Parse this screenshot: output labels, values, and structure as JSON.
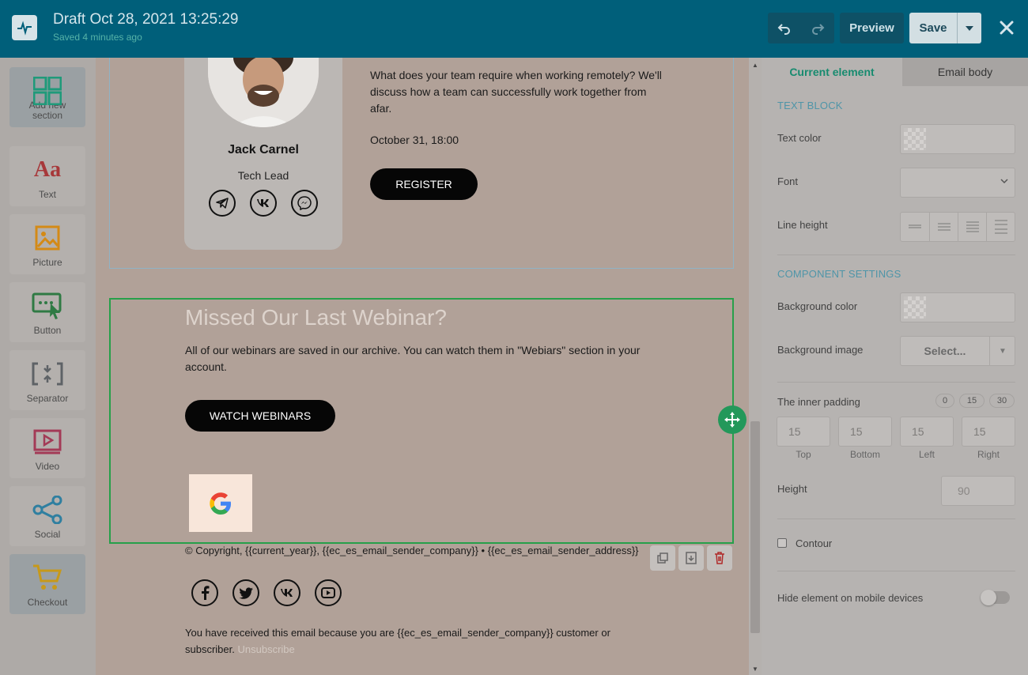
{
  "header": {
    "draft_title": "Draft Oct 28, 2021 13:25:29",
    "saved_status": "Saved 4 minutes ago",
    "preview_label": "Preview",
    "save_label": "Save"
  },
  "toolbox": {
    "items": [
      {
        "label": "Add new section",
        "icon": "add-section-icon"
      },
      {
        "label": "Text",
        "icon": "text-icon"
      },
      {
        "label": "Picture",
        "icon": "picture-icon"
      },
      {
        "label": "Button",
        "icon": "button-icon"
      },
      {
        "label": "Separator",
        "icon": "separator-icon"
      },
      {
        "label": "Video",
        "icon": "video-icon"
      },
      {
        "label": "Social",
        "icon": "social-icon"
      },
      {
        "label": "Checkout",
        "icon": "cart-icon"
      }
    ]
  },
  "email": {
    "profile": {
      "name": "Jack Carnel",
      "role": "Tech Lead"
    },
    "event": {
      "description": "What does your team require when working remotely? We'll discuss how a team can successfully work together from afar.",
      "date": "October 31, 18:00",
      "register_label": "REGISTER"
    },
    "webinar": {
      "title": "Missed Our Last Webinar?",
      "description": "All of our webinars are saved in our archive. You can watch them in \"Webiars\" section in your account.",
      "button_label": "WATCH WEBINARS"
    },
    "footer": {
      "copyright": "© Copyright, {{current_year}}, {{ec_es_email_sender_company}} • {{ec_es_email_sender_address}}",
      "note": "You have received this email because you are {{ec_es_email_sender_company}} customer or subscriber.",
      "unsubscribe": "Unsubscribe"
    }
  },
  "panel": {
    "tabs": {
      "current": "Current element",
      "body": "Email body"
    },
    "text_block_heading": "TEXT BLOCK",
    "text_color_label": "Text color",
    "font_label": "Font",
    "line_height_label": "Line height",
    "component_heading": "COMPONENT SETTINGS",
    "bg_color_label": "Background color",
    "bg_image_label": "Background image",
    "bg_image_select": "Select...",
    "inner_padding_label": "The inner padding",
    "padding_presets": [
      "0",
      "15",
      "30"
    ],
    "padding": {
      "top": "15",
      "bottom": "15",
      "left": "15",
      "right": "15"
    },
    "padding_captions": {
      "top": "Top",
      "bottom": "Bottom",
      "left": "Left",
      "right": "Right"
    },
    "height_label": "Height",
    "height_value": "90",
    "contour_label": "Contour",
    "hide_mobile_label": "Hide element on mobile devices"
  },
  "colors": {
    "topbar": "#005f7a",
    "accent_green": "#27a04a",
    "tab_accent": "#178b6f"
  }
}
